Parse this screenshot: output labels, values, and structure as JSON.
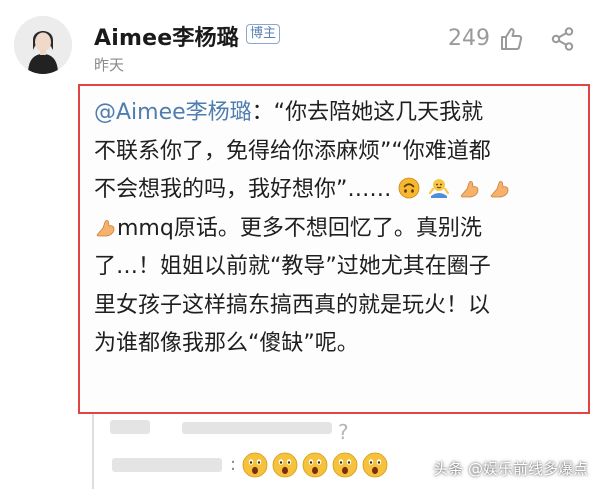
{
  "post": {
    "username": "Aimee李杨璐",
    "badge": "博主",
    "timestamp": "昨天",
    "like_count": "249",
    "icons": {
      "avatar": "avatar",
      "like": "thumbs-up-icon",
      "share": "share-icon"
    }
  },
  "quote": {
    "mention": "@Aimee李杨璐",
    "line1_rest": "：“你去陪她这几天我就",
    "line2": "不联系你了，免得给你添麻烦”“你难道都",
    "line3": "不会想我的吗，我好想你”……",
    "line4_rest": "mmq原话。更多不想回忆了。真别洗",
    "line5": "了…！姐姐以前就“教导”过她尤其在圈子",
    "line6": "里女孩子这样搞东搞西真的就是玩火！以",
    "line7": "为谁都像我那么“傻缺”呢。",
    "emojis": [
      "upside-down-face-emoji",
      "shrug-emoji",
      "flexed-arm-emoji"
    ],
    "border_color": "#e04545"
  },
  "reply": {
    "colon": ":",
    "emoji": "shocked-face-emoji",
    "emoji_count": 5
  },
  "watermark": {
    "text": "头条 @娱乐前线多爆点"
  },
  "colors": {
    "mention": "#507daf",
    "badge_border": "#8aa7cf"
  }
}
